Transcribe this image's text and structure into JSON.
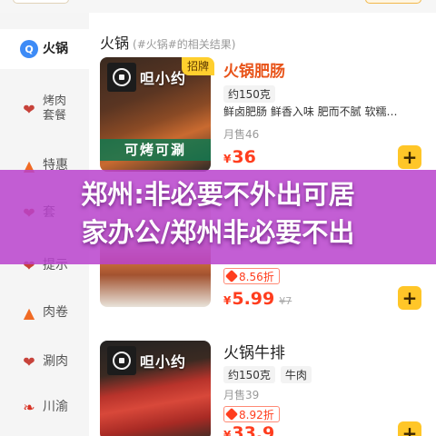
{
  "sidebar": {
    "items": [
      {
        "label": "火锅",
        "icon": "search-icon"
      },
      {
        "label": "烤肉套餐",
        "icon": "meat-icon"
      },
      {
        "label": "特惠",
        "icon": "fire-icon"
      },
      {
        "label": "套",
        "icon": "meat-icon"
      },
      {
        "label": "提示",
        "icon": "meat-icon"
      },
      {
        "label": "肉卷",
        "icon": "fire-icon"
      },
      {
        "label": "涮肉",
        "icon": "meat-icon"
      },
      {
        "label": "川渝",
        "icon": "pepper-icon"
      }
    ]
  },
  "section": {
    "title": "火锅",
    "subtitle": "(#火锅#的相关结果)"
  },
  "products": [
    {
      "tag": "招牌",
      "name": "火锅肥肠",
      "spec": "约150克",
      "desc": "鲜卤肥肠 鲜香入味 肥而不腻 软糯…",
      "sold": "月售46",
      "currency": "¥",
      "price": "36",
      "brand": "呾小约",
      "promo": "可烤可涮"
    },
    {
      "discount": "8.56折",
      "currency": "¥",
      "price": "5.99",
      "original_price": "¥7"
    },
    {
      "name": "火锅牛排",
      "spec": "约150克",
      "spec2": "牛肉",
      "sold": "月售39",
      "discount": "8.92折",
      "currency": "¥",
      "price": "33.9",
      "brand": "呾小约"
    }
  ],
  "overlay": {
    "line1": "郑州:非必要不外出可居",
    "line2": "家办公/郑州非必要不出"
  },
  "colors": {
    "accent": "#ffc628",
    "price": "#ff3d1e",
    "highlight_name": "#e8541a",
    "overlay": "#b842cd"
  }
}
